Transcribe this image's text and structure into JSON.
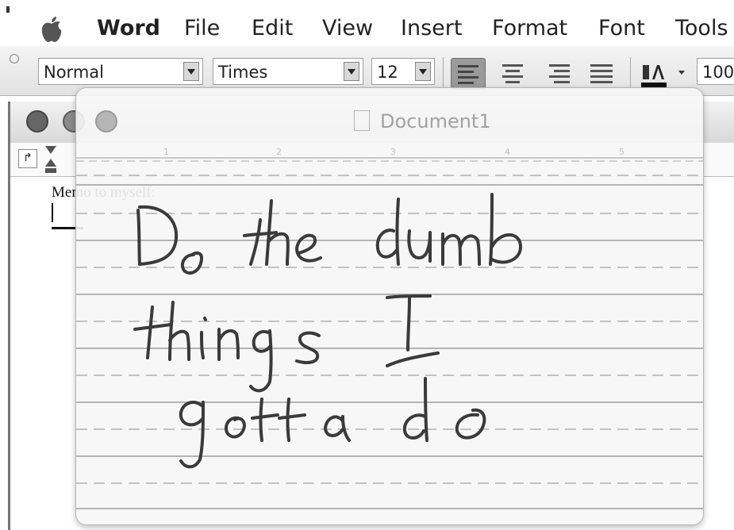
{
  "menubar": {
    "app": "Word",
    "items": [
      "File",
      "Edit",
      "View",
      "Insert",
      "Format",
      "Font",
      "Tools"
    ]
  },
  "toolbar": {
    "style": "Normal",
    "font": "Times",
    "size": "12",
    "zoom": "100",
    "alignments": [
      "align-left",
      "align-center",
      "align-right",
      "justify"
    ],
    "active_alignment": "align-left",
    "highlight_icon": "highlight-icon"
  },
  "document": {
    "title": "Document1",
    "memo_label": "Memo to myself:",
    "ruler_ticks": [
      "1",
      "2",
      "3",
      "4",
      "5"
    ]
  },
  "ink_pad": {
    "title": "Document1",
    "handwriting": [
      "Do the dumb",
      "things I",
      "gotta do"
    ]
  },
  "colors": {
    "menubar_bg": "#ffffff",
    "pad_bg": "#f6f6f6",
    "line_solid": "#b4b4b4",
    "ink": "#3a3a3a"
  }
}
